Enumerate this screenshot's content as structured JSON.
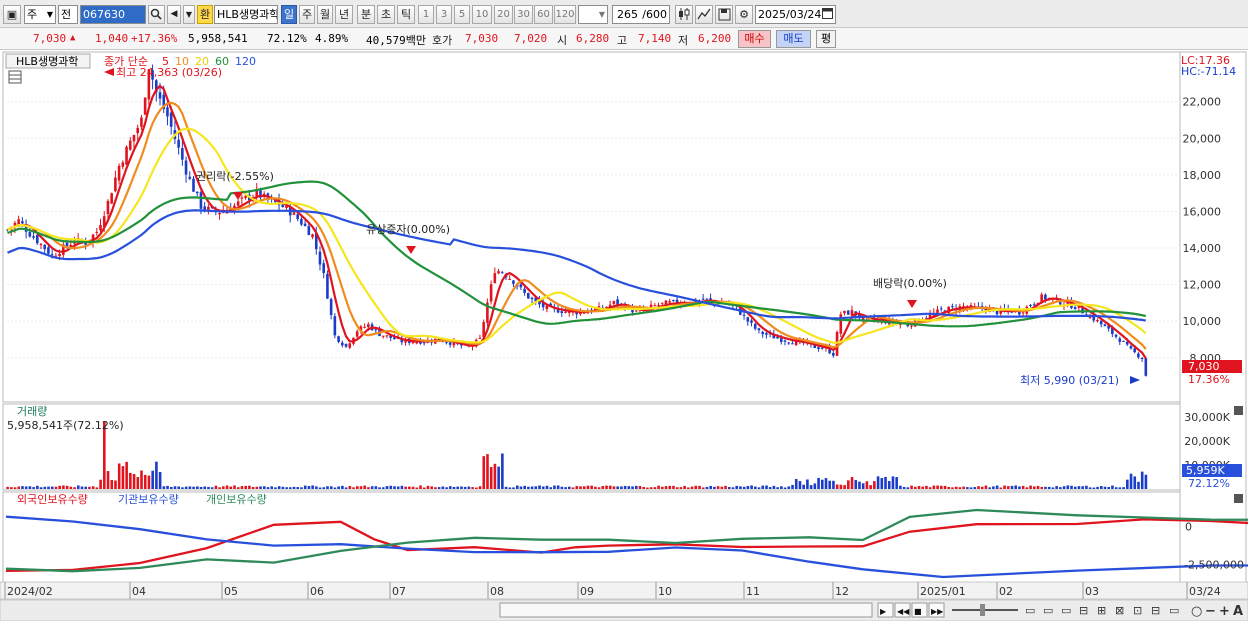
{
  "toolbar": {
    "period_type": "주",
    "mode": "전",
    "stock_code": "067630",
    "badge": "환",
    "stock_name": "HLB생명과학",
    "intervals": [
      "일",
      "주",
      "월",
      "년",
      "분",
      "초",
      "틱"
    ],
    "selected_interval": "일",
    "minute_presets": [
      "1",
      "3",
      "5",
      "10",
      "20",
      "30",
      "60",
      "120"
    ],
    "count": "265",
    "count_total": "/600",
    "date": "2025/03/24"
  },
  "quote": {
    "price": "7,030",
    "change": "1,040",
    "change_pct": "+17.36%",
    "volume": "5,958,541",
    "volume_ratio": "72.12%",
    "turnover_ratio": "4.89%",
    "amount": "40,579백만",
    "hoga_label": "호가",
    "ask": "7,030",
    "bid": "7,020",
    "open_label": "시",
    "open": "6,280",
    "high_label": "고",
    "high": "7,140",
    "low_label": "저",
    "low": "6,200",
    "buy_label": "매수",
    "sell_label": "매도",
    "eval_label": "평"
  },
  "legend": {
    "stock": "HLB생명과학",
    "ma_title": "종가 단순",
    "ma_periods": [
      "5",
      "10",
      "20",
      "60",
      "120"
    ],
    "volume_title": "거래량",
    "volume_value": "5,958,541주(72.12%)",
    "holding_series": [
      "외국인보유수량",
      "기관보유수량",
      "개인보유수량"
    ]
  },
  "annotations": {
    "high": "최고 24,363 (03/26)",
    "low": "최저 5,990 (03/21)",
    "ex_rights": "권리락(-2.55%)",
    "rights_offering": "유상증자(0.00%)",
    "ex_dividend": "배당락(0.00%)",
    "lc": "LC:17.36",
    "hc": "HC:-71.14",
    "last_price": "7,030",
    "last_pct": "17.36%",
    "last_volume": "5,959K",
    "last_volume_pct": "72.12%"
  },
  "colors": {
    "up": "#e0141e",
    "down": "#1a3cc8",
    "ma5": "#e0141e",
    "ma10": "#f08c1e",
    "ma20": "#f5e61e",
    "ma60": "#21913a",
    "ma120": "#2850dc",
    "foreign": "#e0141e",
    "institution": "#2850dc",
    "individual": "#2e8a5a"
  },
  "chart_data": [
    {
      "type": "candlestick",
      "title": "HLB생명과학",
      "x_ticks": [
        "2024/02",
        "04",
        "05",
        "06",
        "07",
        "08",
        "09",
        "10",
        "11",
        "12",
        "2025/01",
        "02",
        "03",
        "03/24"
      ],
      "y_ticks": [
        "22,000",
        "20,000",
        "18,000",
        "16,000",
        "14,000",
        "12,000",
        "10,000",
        "8,000"
      ],
      "ylim": [
        5800,
        24500
      ],
      "price_path": [
        [
          0,
          15000
        ],
        [
          3,
          15500
        ],
        [
          6,
          14800
        ],
        [
          9,
          14200
        ],
        [
          12,
          13600
        ],
        [
          15,
          14000
        ],
        [
          18,
          14400
        ],
        [
          21,
          14300
        ],
        [
          24,
          14900
        ],
        [
          27,
          16500
        ],
        [
          30,
          18500
        ],
        [
          33,
          19800
        ],
        [
          36,
          21000
        ],
        [
          38,
          24000
        ],
        [
          40,
          22500
        ],
        [
          43,
          21200
        ],
        [
          46,
          19400
        ],
        [
          49,
          17700
        ],
        [
          52,
          16300
        ],
        [
          55,
          16000
        ],
        [
          58,
          16000
        ],
        [
          61,
          16300
        ],
        [
          64,
          16700
        ],
        [
          67,
          17000
        ],
        [
          70,
          16600
        ],
        [
          73,
          16400
        ],
        [
          76,
          16000
        ],
        [
          79,
          15400
        ],
        [
          82,
          14700
        ],
        [
          85,
          12500
        ],
        [
          88,
          9200
        ],
        [
          91,
          8600
        ],
        [
          94,
          9500
        ],
        [
          97,
          9800
        ],
        [
          100,
          9300
        ],
        [
          103,
          9100
        ],
        [
          106,
          8900
        ],
        [
          109,
          8900
        ],
        [
          112,
          8900
        ],
        [
          115,
          9000
        ],
        [
          118,
          8900
        ],
        [
          121,
          8700
        ],
        [
          124,
          8600
        ],
        [
          127,
          9000
        ],
        [
          129,
          11000
        ],
        [
          131,
          12800
        ],
        [
          133,
          12700
        ],
        [
          136,
          12200
        ],
        [
          139,
          11500
        ],
        [
          142,
          11000
        ],
        [
          145,
          10700
        ],
        [
          148,
          10600
        ],
        [
          151,
          10500
        ],
        [
          154,
          10500
        ],
        [
          157,
          10600
        ],
        [
          160,
          10700
        ],
        [
          163,
          11000
        ],
        [
          166,
          10800
        ],
        [
          169,
          10500
        ],
        [
          172,
          10700
        ],
        [
          175,
          10900
        ],
        [
          178,
          11000
        ],
        [
          181,
          11000
        ],
        [
          184,
          11000
        ],
        [
          187,
          11200
        ],
        [
          190,
          11000
        ],
        [
          193,
          11000
        ],
        [
          196,
          10700
        ],
        [
          199,
          10000
        ],
        [
          202,
          9400
        ],
        [
          205,
          9200
        ],
        [
          208,
          9000
        ],
        [
          211,
          8900
        ],
        [
          214,
          8800
        ],
        [
          217,
          8600
        ],
        [
          220,
          8500
        ],
        [
          222,
          8200
        ],
        [
          224,
          10400
        ],
        [
          227,
          10500
        ],
        [
          230,
          10100
        ],
        [
          233,
          10100
        ],
        [
          236,
          10000
        ],
        [
          239,
          9900
        ],
        [
          242,
          9800
        ],
        [
          245,
          10100
        ],
        [
          248,
          10300
        ],
        [
          251,
          10600
        ],
        [
          254,
          10700
        ],
        [
          257,
          10800
        ],
        [
          260,
          10700
        ],
        [
          263,
          10700
        ],
        [
          266,
          10500
        ],
        [
          269,
          10600
        ],
        [
          272,
          10500
        ],
        [
          275,
          10900
        ],
        [
          278,
          11300
        ],
        [
          281,
          11200
        ],
        [
          284,
          11000
        ],
        [
          287,
          10800
        ],
        [
          290,
          10400
        ],
        [
          293,
          10000
        ],
        [
          296,
          9500
        ],
        [
          299,
          9000
        ],
        [
          302,
          8400
        ],
        [
          305,
          8000
        ],
        [
          306,
          7030
        ]
      ],
      "ma_periods": [
        5,
        10,
        20,
        60,
        120
      ]
    },
    {
      "type": "bar",
      "title": "거래량",
      "y_ticks": [
        "30,000K",
        "20,000K",
        "10,000K"
      ],
      "ylim": [
        0,
        33000
      ],
      "last_value_k": 5959
    },
    {
      "type": "line",
      "title": "외국인보유수량 / 기관보유수량 / 개인보유수량",
      "y_ticks": [
        "0",
        "-2,500,000"
      ],
      "series": [
        {
          "name": "외국인보유수량",
          "points": [
            [
              0,
              -3000000
            ],
            [
              10,
              -2800000
            ],
            [
              20,
              -2400000
            ],
            [
              30,
              -1500000
            ],
            [
              40,
              200000
            ],
            [
              50,
              300000
            ],
            [
              55,
              -800000
            ],
            [
              60,
              -1600000
            ],
            [
              70,
              -1400000
            ],
            [
              80,
              -1700000
            ],
            [
              85,
              -1400000
            ],
            [
              90,
              -1200000
            ],
            [
              100,
              -1200000
            ],
            [
              110,
              -1300000
            ],
            [
              120,
              -1300000
            ],
            [
              128,
              -1300000
            ],
            [
              135,
              -400000
            ],
            [
              145,
              100000
            ],
            [
              160,
              200000
            ],
            [
              170,
              400000
            ],
            [
              180,
              300000
            ],
            [
              200,
              -100000
            ],
            [
              220,
              -800000
            ],
            [
              240,
              -600000
            ],
            [
              260,
              -300000
            ],
            [
              280,
              -600000
            ],
            [
              300,
              -100000
            ],
            [
              320,
              0
            ],
            [
              340,
              100000
            ],
            [
              360,
              0
            ],
            [
              380,
              -100000
            ],
            [
              400,
              100000
            ],
            [
              420,
              0
            ],
            [
              437,
              -200000
            ],
            [
              446,
              900000
            ]
          ]
        },
        {
          "name": "기관보유수량",
          "points": [
            [
              0,
              600000
            ],
            [
              10,
              300000
            ],
            [
              20,
              -200000
            ],
            [
              30,
              -800000
            ],
            [
              40,
              -1200000
            ],
            [
              50,
              -1200000
            ],
            [
              60,
              -1400000
            ],
            [
              70,
              -1600000
            ],
            [
              80,
              -1700000
            ],
            [
              90,
              -1600000
            ],
            [
              100,
              -1400000
            ],
            [
              110,
              -1600000
            ],
            [
              120,
              -2300000
            ],
            [
              128,
              -2800000
            ],
            [
              140,
              -3300000
            ],
            [
              160,
              -2900000
            ],
            [
              180,
              -2600000
            ],
            [
              200,
              -2500000
            ],
            [
              220,
              -2600000
            ],
            [
              240,
              -2300000
            ],
            [
              260,
              -1600000
            ],
            [
              280,
              -600000
            ],
            [
              300,
              100000
            ],
            [
              320,
              300000
            ],
            [
              340,
              -100000
            ],
            [
              360,
              -200000
            ],
            [
              380,
              -100000
            ],
            [
              400,
              -600000
            ],
            [
              420,
              -1800000
            ],
            [
              437,
              -2800000
            ],
            [
              446,
              -3100000
            ]
          ]
        },
        {
          "name": "개인보유수량",
          "points": [
            [
              0,
              -2800000
            ],
            [
              10,
              -2900000
            ],
            [
              20,
              -2700000
            ],
            [
              30,
              -2100000
            ],
            [
              40,
              -2300000
            ],
            [
              50,
              -1600000
            ],
            [
              60,
              -1000000
            ],
            [
              70,
              -800000
            ],
            [
              80,
              -900000
            ],
            [
              90,
              -800000
            ],
            [
              100,
              -1000000
            ],
            [
              110,
              -800000
            ],
            [
              120,
              -700000
            ],
            [
              128,
              -800000
            ],
            [
              135,
              700000
            ],
            [
              145,
              1100000
            ],
            [
              160,
              800000
            ],
            [
              180,
              500000
            ],
            [
              200,
              400000
            ],
            [
              220,
              600000
            ],
            [
              240,
              400000
            ],
            [
              260,
              -200000
            ],
            [
              280,
              -100000
            ],
            [
              300,
              0
            ],
            [
              320,
              -300000
            ],
            [
              340,
              -100000
            ],
            [
              360,
              -200000
            ],
            [
              380,
              100000
            ],
            [
              400,
              200000
            ],
            [
              420,
              600000
            ],
            [
              437,
              500000
            ],
            [
              446,
              400000
            ]
          ]
        }
      ]
    }
  ]
}
